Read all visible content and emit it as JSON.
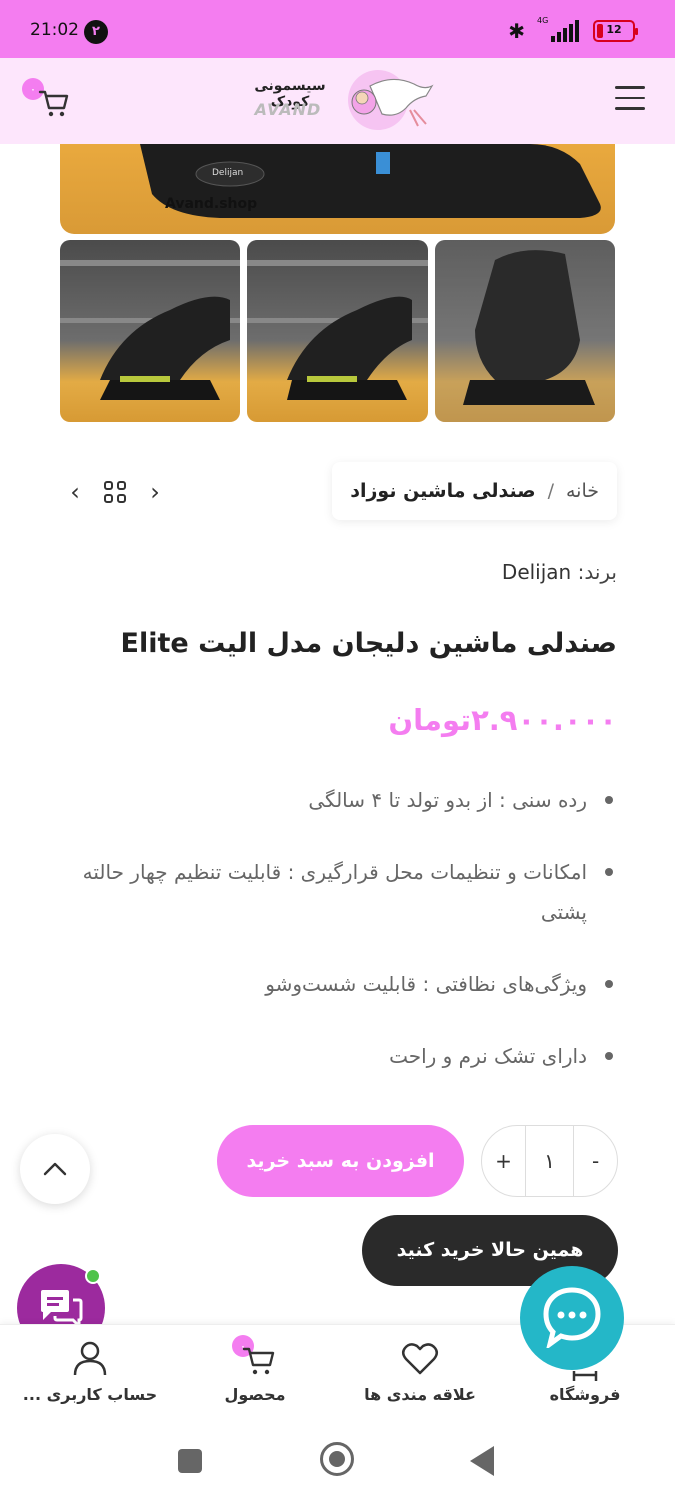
{
  "status_bar": {
    "time": "21:02",
    "notification_count": "۲",
    "network": "4G",
    "battery": "12"
  },
  "header": {
    "cart_count": "۰",
    "logo_text": "سیسمونی کودک",
    "logo_brand": "AVAND"
  },
  "gallery": {
    "watermark": "Avand.shop",
    "main_brand": "Delijan"
  },
  "breadcrumb": {
    "home": "خانه",
    "separator": "/",
    "current": "صندلی ماشین نوزاد"
  },
  "product": {
    "brand_label": "برند:",
    "brand_value": "Delijan",
    "title": "صندلی ماشین دلیجان مدل الیت Elite",
    "price": "۲.۹۰۰.۰۰۰تومان",
    "features": [
      "رده سنی : از بدو تولد تا ۴ سالگی",
      "امکانات و تنظیمات محل قرارگیری : قابلیت تنظیم چهار حالته پشتی",
      "ویژگی‌های نظافتی : قابلیت شست‌وشو",
      "دارای تشک نرم و راحت"
    ]
  },
  "purchase": {
    "minus": "-",
    "quantity": "۱",
    "plus": "+",
    "add_to_cart": "افزودن به سبد خرید",
    "buy_now": "همین حالا خرید کنید"
  },
  "bottom_nav": {
    "shop": "فروشگاه",
    "favorites": "علاقه مندی ها",
    "product": "محصول",
    "product_badge": "۰",
    "account": "حساب کاربری ..."
  },
  "colors": {
    "accent": "#f47df0",
    "dark_button": "#2a2a2a",
    "chat": "#9c2a9e",
    "messenger": "#24b7c8"
  }
}
